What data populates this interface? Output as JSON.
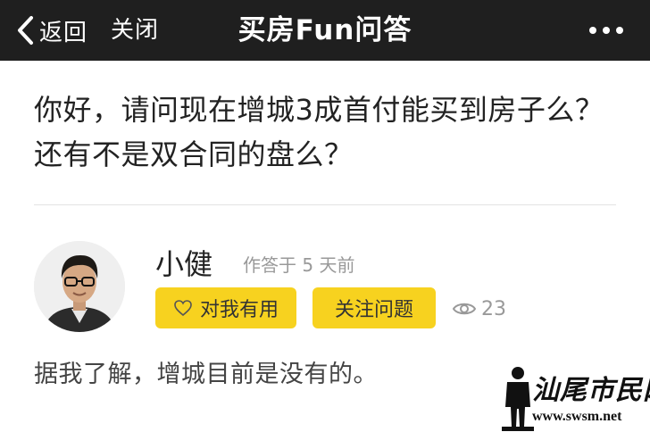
{
  "navbar": {
    "back_label": "返回",
    "close_label": "关闭",
    "title": "买房Fun问答",
    "more_icon": "more-dots-icon"
  },
  "question": {
    "text": "你好，请问现在增城3成首付能买到房子么？还有不是双合同的盘么？"
  },
  "answer": {
    "author": "小健",
    "meta": "作答于 5 天前",
    "useful_label": "对我有用",
    "follow_label": "关注问题",
    "views": "23",
    "body": "据我了解，增城目前是没有的。"
  },
  "watermark": {
    "text": "汕尾市民网",
    "url": "www.swsm.net"
  },
  "colors": {
    "navbar_bg": "#1f1f1f",
    "accent_yellow": "#f7d21f",
    "muted_text": "#999999"
  }
}
